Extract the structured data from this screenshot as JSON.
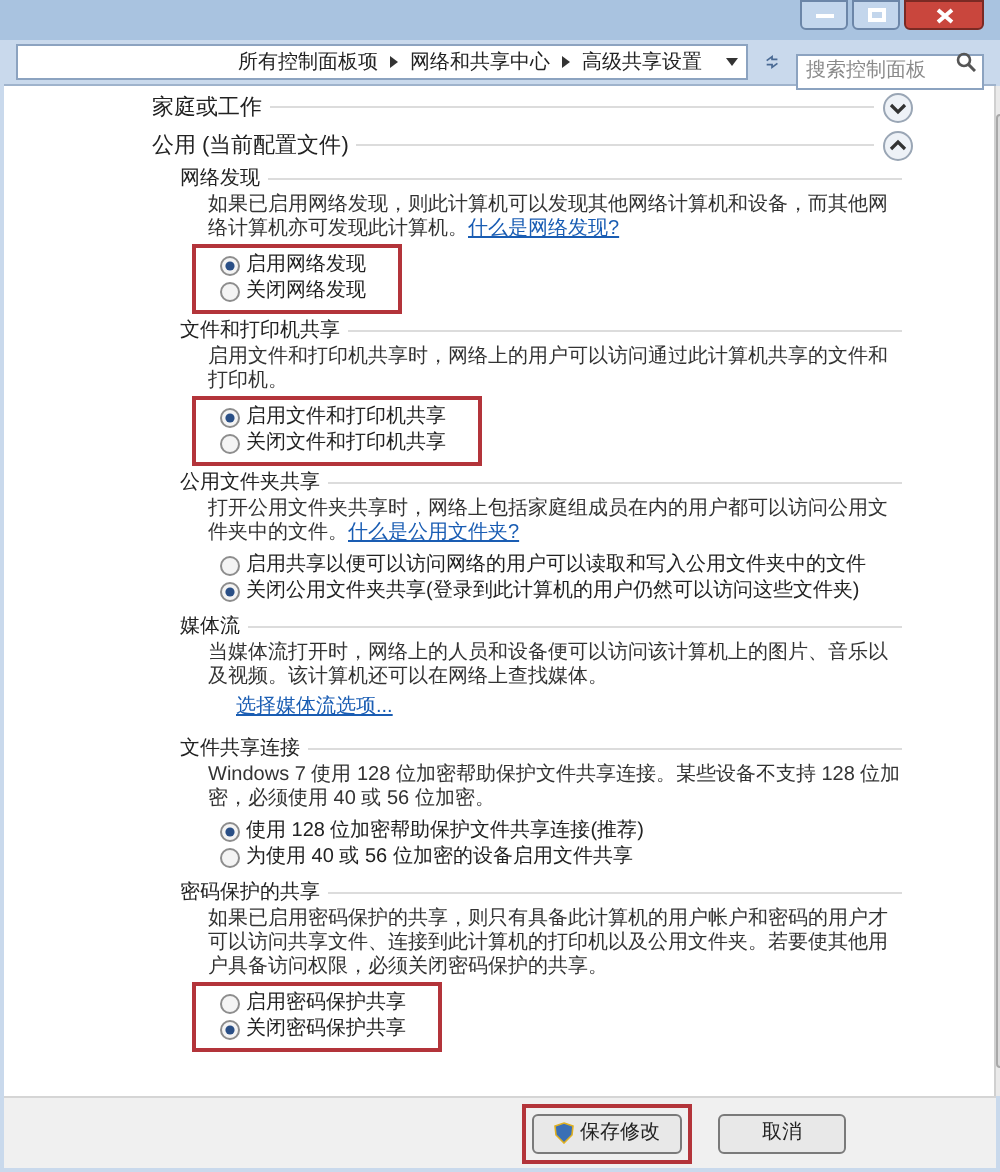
{
  "address_bar": {
    "breadcrumb": [
      "所有控制面板项",
      "网络和共享中心",
      "高级共享设置"
    ],
    "search": {
      "placeholder": "搜索控制面板"
    }
  },
  "profiles": [
    {
      "title": "家庭或工作",
      "expanded": false
    },
    {
      "title": "公用 (当前配置文件)",
      "expanded": true,
      "sections": [
        {
          "title": "网络发现",
          "description": "如果已启用网络发现，则此计算机可以发现其他网络计算机和设备，而其他网络计算机亦可发现此计算机。",
          "link": "什么是网络发现?",
          "highlighted": true,
          "options": [
            {
              "label": "启用网络发现",
              "selected": true
            },
            {
              "label": "关闭网络发现",
              "selected": false
            }
          ]
        },
        {
          "title": "文件和打印机共享",
          "description": "启用文件和打印机共享时，网络上的用户可以访问通过此计算机共享的文件和打印机。",
          "highlighted": true,
          "options": [
            {
              "label": "启用文件和打印机共享",
              "selected": true
            },
            {
              "label": "关闭文件和打印机共享",
              "selected": false
            }
          ]
        },
        {
          "title": "公用文件夹共享",
          "description": "打开公用文件夹共享时，网络上包括家庭组成员在内的用户都可以访问公用文件夹中的文件。",
          "link": "什么是公用文件夹?",
          "options": [
            {
              "label": "启用共享以便可以访问网络的用户可以读取和写入公用文件夹中的文件",
              "selected": false
            },
            {
              "label": "关闭公用文件夹共享(登录到此计算机的用户仍然可以访问这些文件夹)",
              "selected": true
            }
          ]
        },
        {
          "title": "媒体流",
          "description": "当媒体流打开时，网络上的人员和设备便可以访问该计算机上的图片、音乐以及视频。该计算机还可以在网络上查找媒体。",
          "options_link": "选择媒体流选项..."
        },
        {
          "title": "文件共享连接",
          "description": "Windows 7 使用 128 位加密帮助保护文件共享连接。某些设备不支持 128 位加密，必须使用 40 或 56 位加密。",
          "options": [
            {
              "label": "使用 128 位加密帮助保护文件共享连接(推荐)",
              "selected": true
            },
            {
              "label": "为使用 40 或 56 位加密的设备启用文件共享",
              "selected": false
            }
          ]
        },
        {
          "title": "密码保护的共享",
          "description": "如果已启用密码保护的共享，则只有具备此计算机的用户帐户和密码的用户才可以访问共享文件、连接到此计算机的打印机以及公用文件夹。若要使其他用户具备访问权限，必须关闭密码保护的共享。",
          "highlighted": true,
          "options": [
            {
              "label": "启用密码保护共享",
              "selected": false
            },
            {
              "label": "关闭密码保护共享",
              "selected": true
            }
          ]
        }
      ]
    }
  ],
  "buttons": [
    {
      "label": "保存修改",
      "kind": "shield",
      "highlighted": true
    },
    {
      "label": "取消",
      "kind": "plain"
    }
  ]
}
